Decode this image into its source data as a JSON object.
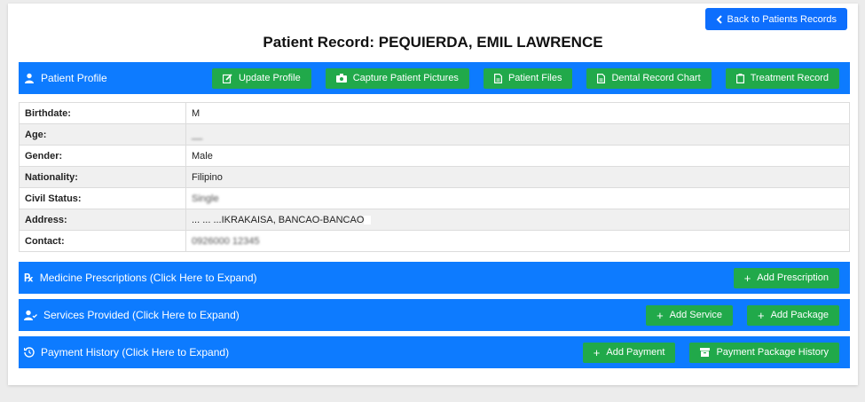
{
  "header": {
    "back_label": "Back to Patients Records",
    "title": "Patient Record: PEQUIERDA, EMIL LAWRENCE"
  },
  "profile_bar": {
    "label": "Patient Profile",
    "buttons": [
      {
        "label": "Update Profile",
        "icon": "edit-icon"
      },
      {
        "label": "Capture Patient Pictures",
        "icon": "camera-icon"
      },
      {
        "label": "Patient Files",
        "icon": "file-icon"
      },
      {
        "label": "Dental Record Chart",
        "icon": "file-icon"
      },
      {
        "label": "Treatment Record",
        "icon": "clipboard-icon"
      }
    ]
  },
  "profile": {
    "birthdate_label": "Birthdate:",
    "birthdate_value": "M",
    "age_label": "Age:",
    "age_value": "__",
    "gender_label": "Gender:",
    "gender_value": "Male",
    "nationality_label": "Nationality:",
    "nationality_value": "Filipino",
    "civil_label": "Civil Status:",
    "civil_value": "Single",
    "address_label": "Address:",
    "address_value": "... ... ...IKRAKAISA, BANCAO-BANCAO",
    "contact_label": "Contact:",
    "contact_value": "0926000 12345"
  },
  "sections": {
    "prescriptions": {
      "label": "Medicine Prescriptions (Click Here to Expand)",
      "btn": "Add Prescription"
    },
    "services": {
      "label": "Services Provided (Click Here to Expand)",
      "btn1": "Add Service",
      "btn2": "Add Package"
    },
    "payments": {
      "label": "Payment History (Click Here to Expand)",
      "btn1": "Add Payment",
      "btn2": "Payment Package History"
    }
  },
  "colors": {
    "primary": "#0d7bff",
    "success": "#21a94a"
  }
}
